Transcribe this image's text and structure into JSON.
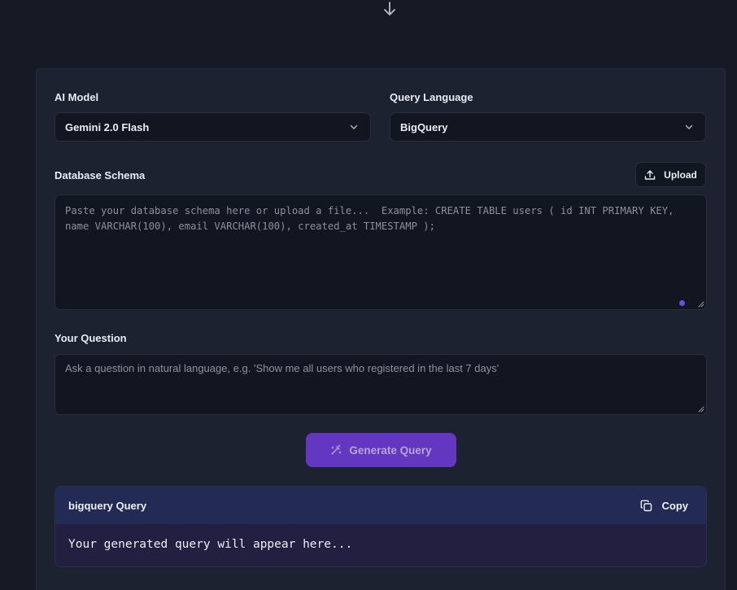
{
  "form": {
    "model_label": "AI Model",
    "model_value": "Gemini 2.0 Flash",
    "language_label": "Query Language",
    "language_value": "BigQuery",
    "schema_label": "Database Schema",
    "upload_label": "Upload",
    "schema_placeholder": "Paste your database schema here or upload a file...  Example: CREATE TABLE users ( id INT PRIMARY KEY, name VARCHAR(100), email VARCHAR(100), created_at TIMESTAMP );",
    "question_label": "Your Question",
    "question_placeholder": "Ask a question in natural language, e.g. 'Show me all users who registered in the last 7 days'",
    "generate_label": "Generate Query"
  },
  "result": {
    "title": "bigquery Query",
    "copy_label": "Copy",
    "placeholder": "Your generated query will appear here..."
  },
  "colors": {
    "background": "#161a25",
    "panel": "#1d2230",
    "input": "#121620",
    "accent": "#6437c0",
    "result_header": "#232a53",
    "result_body": "#231f40"
  },
  "icons": [
    "arrow-down-icon",
    "chevron-down-icon",
    "upload-icon",
    "magic-wand-icon",
    "copy-icon",
    "resize-grip-icon"
  ]
}
